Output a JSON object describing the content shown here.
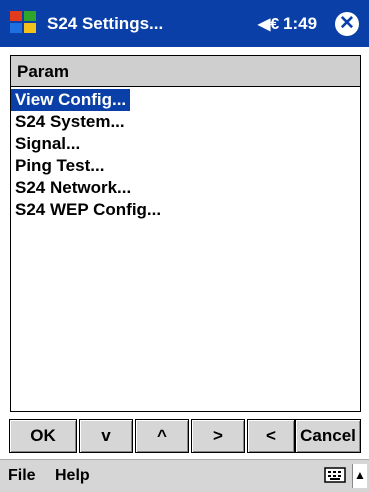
{
  "titlebar": {
    "title": "S24 Settings...",
    "volume_icon": "speaker-icon",
    "time": "1:49",
    "close_label": "✕"
  },
  "list": {
    "header": "Param",
    "items": [
      "View Config...",
      "S24 System...",
      "Signal...",
      "Ping Test...",
      "S24 Network...",
      "S24 WEP Config..."
    ],
    "selected_index": 0
  },
  "buttons": [
    "OK",
    "v",
    "^",
    ">",
    "<",
    "Cancel"
  ],
  "menubar": {
    "file": "File",
    "help": "Help",
    "arrow": "▲"
  },
  "colors": {
    "titlebar": "#0a3fa8",
    "selection": "#0a3fa8",
    "header": "#cfcfcf",
    "button": "#d6d6d6"
  }
}
